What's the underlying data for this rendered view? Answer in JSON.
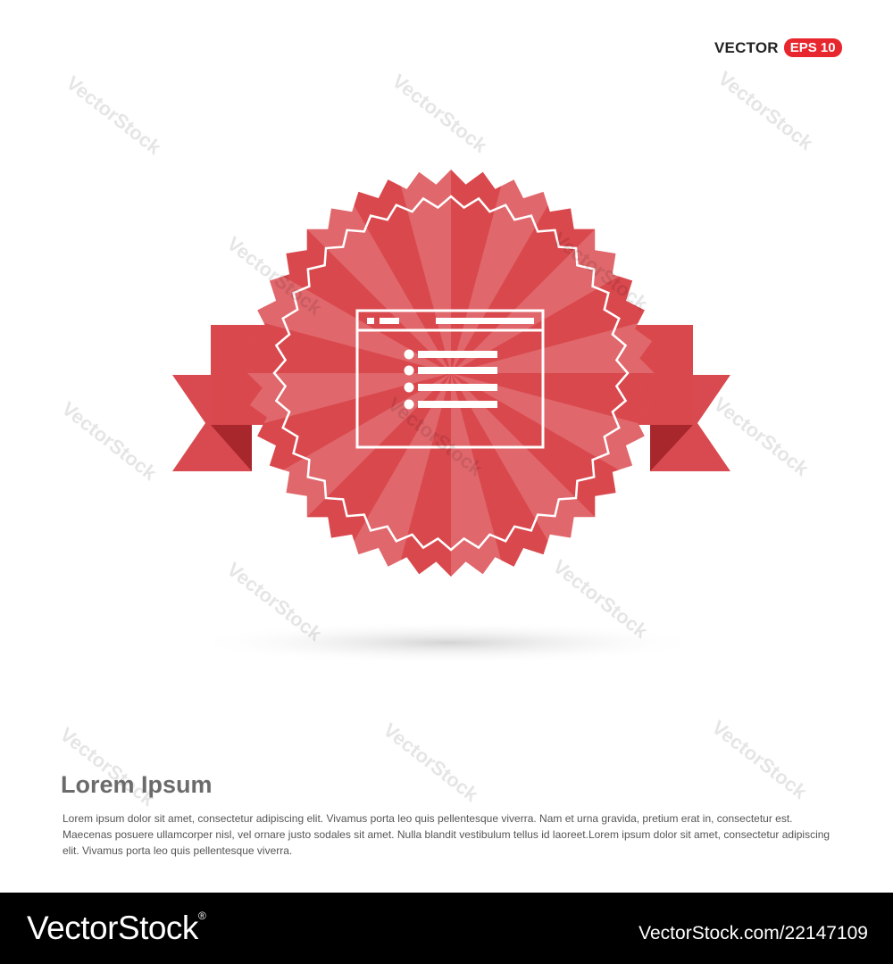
{
  "tag": {
    "vector": "VECTOR",
    "eps": "EPS 10"
  },
  "watermark": {
    "text": "VectorStock"
  },
  "colors": {
    "badge": "#d9484d",
    "badge_dark": "#b93237",
    "ribbon": "#d84a4f",
    "accent": "#e8262e",
    "footer_bg": "#000000"
  },
  "badge": {
    "icon": "browser-list-icon"
  },
  "heading": "Lorem Ipsum",
  "body": "Lorem ipsum dolor sit amet, consectetur adipiscing elit. Vivamus porta leo quis pellentesque viverra. Nam et urna gravida, pretium erat in, consectetur est. Maecenas posuere ullamcorper nisl, vel ornare justo sodales sit amet. Nulla blandit vestibulum tellus id laoreet.Lorem ipsum dolor sit amet, consectetur adipiscing elit. Vivamus porta leo quis pellentesque viverra.",
  "footer": {
    "logo": "VectorStock",
    "logo_mark": "®",
    "id": "VectorStock.com/22147109"
  }
}
